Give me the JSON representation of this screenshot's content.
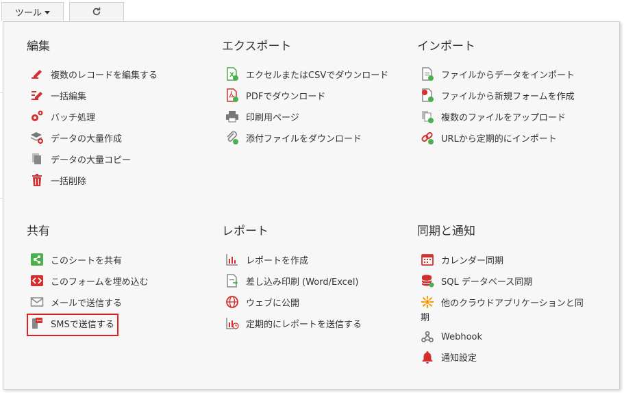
{
  "toolbar": {
    "tools_label": "ツール",
    "refresh_icon": "refresh-icon"
  },
  "sections": {
    "edit": {
      "title": "編集",
      "items": [
        {
          "label": "複数のレコードを編集する",
          "icon": "edit-multiple-icon"
        },
        {
          "label": "一括編集",
          "icon": "bulk-edit-icon"
        },
        {
          "label": "バッチ処理",
          "icon": "gears-icon"
        },
        {
          "label": "データの大量作成",
          "icon": "layers-add-icon"
        },
        {
          "label": "データの大量コピー",
          "icon": "copy-icon"
        },
        {
          "label": "一括削除",
          "icon": "trash-icon"
        }
      ]
    },
    "export": {
      "title": "エクスポート",
      "items": [
        {
          "label": "エクセルまたはCSVでダウンロード",
          "icon": "excel-icon"
        },
        {
          "label": "PDFでダウンロード",
          "icon": "pdf-icon"
        },
        {
          "label": "印刷用ページ",
          "icon": "printer-icon"
        },
        {
          "label": "添付ファイルをダウンロード",
          "icon": "paperclip-download-icon"
        }
      ]
    },
    "import": {
      "title": "インポート",
      "items": [
        {
          "label": "ファイルからデータをインポート",
          "icon": "file-import-icon"
        },
        {
          "label": "ファイルから新規フォームを作成",
          "icon": "file-new-form-icon"
        },
        {
          "label": "複数のファイルをアップロード",
          "icon": "files-upload-icon"
        },
        {
          "label": "URLから定期的にインポート",
          "icon": "link-import-icon"
        }
      ]
    },
    "share": {
      "title": "共有",
      "items": [
        {
          "label": "このシートを共有",
          "icon": "share-icon"
        },
        {
          "label": "このフォームを埋め込む",
          "icon": "embed-code-icon"
        },
        {
          "label": "メールで送信する",
          "icon": "envelope-icon"
        },
        {
          "label": "SMSで送信する",
          "icon": "sms-icon"
        }
      ]
    },
    "report": {
      "title": "レポート",
      "items": [
        {
          "label": "レポートを作成",
          "icon": "bar-chart-icon"
        },
        {
          "label": "差し込み印刷 (Word/Excel)",
          "icon": "mail-merge-icon"
        },
        {
          "label": "ウェブに公開",
          "icon": "globe-icon"
        },
        {
          "label": "定期的にレポートを送信する",
          "icon": "scheduled-report-icon"
        }
      ]
    },
    "sync": {
      "title": "同期と通知",
      "items": [
        {
          "label": "カレンダー同期",
          "icon": "calendar-icon"
        },
        {
          "label": "SQL データベース同期",
          "icon": "database-icon"
        },
        {
          "label": "他のクラウドアプリケーションと同",
          "label_wrap": "期",
          "icon": "cloud-apps-icon"
        },
        {
          "label": "Webhook",
          "icon": "webhook-icon"
        },
        {
          "label": "通知設定",
          "icon": "bell-icon"
        }
      ]
    }
  },
  "colors": {
    "accent_red": "#d32f2f",
    "green": "#4caf50",
    "orange": "#ff9800",
    "gray": "#777777",
    "highlight": "#e02020"
  }
}
